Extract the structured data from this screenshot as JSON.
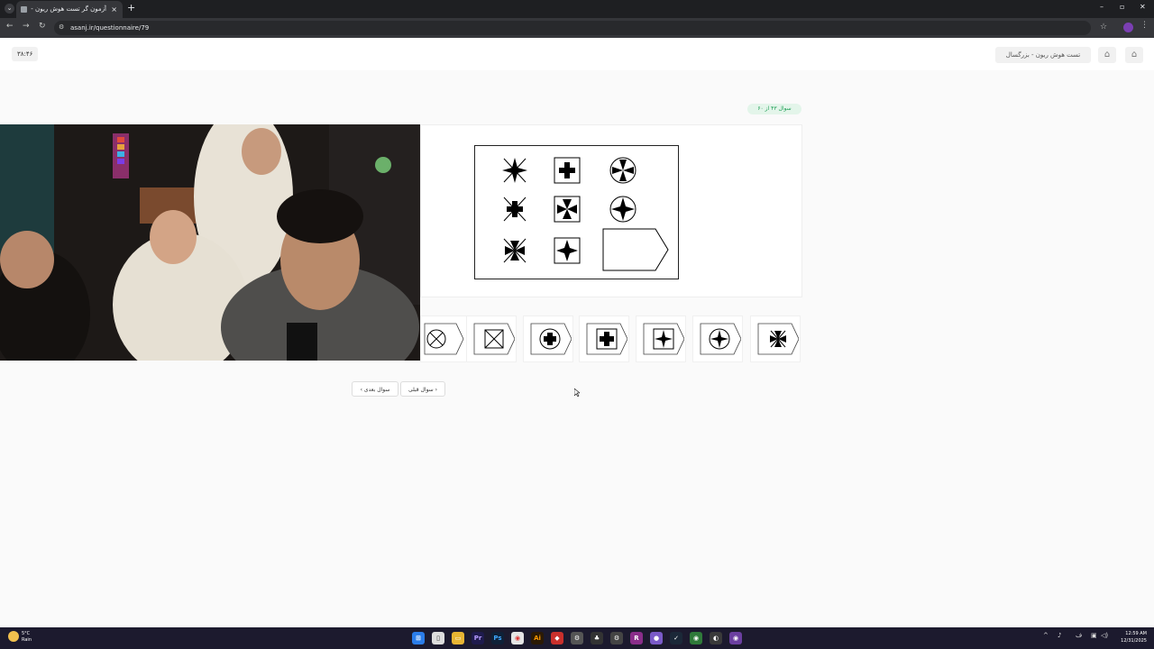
{
  "browser": {
    "tab_title": "آزمون گر تست هوش ریون - بزرگ",
    "url": "asanj.ir/questionnaire/79",
    "new_tab": "+",
    "close_tab": "×"
  },
  "header": {
    "timer": "۳۸:۴۶",
    "test_title": "تست هوش ریون - بزرگسال"
  },
  "question": {
    "counter": "سوال ۴۳ از ۶۰"
  },
  "navigation": {
    "next_label": "سوال بعدی",
    "prev_label": "سوال قبلی"
  },
  "taskbar": {
    "temp": "5°C",
    "condition": "Rain",
    "time": "12:59 AM",
    "date": "12/31/2025",
    "lang": "ف"
  }
}
